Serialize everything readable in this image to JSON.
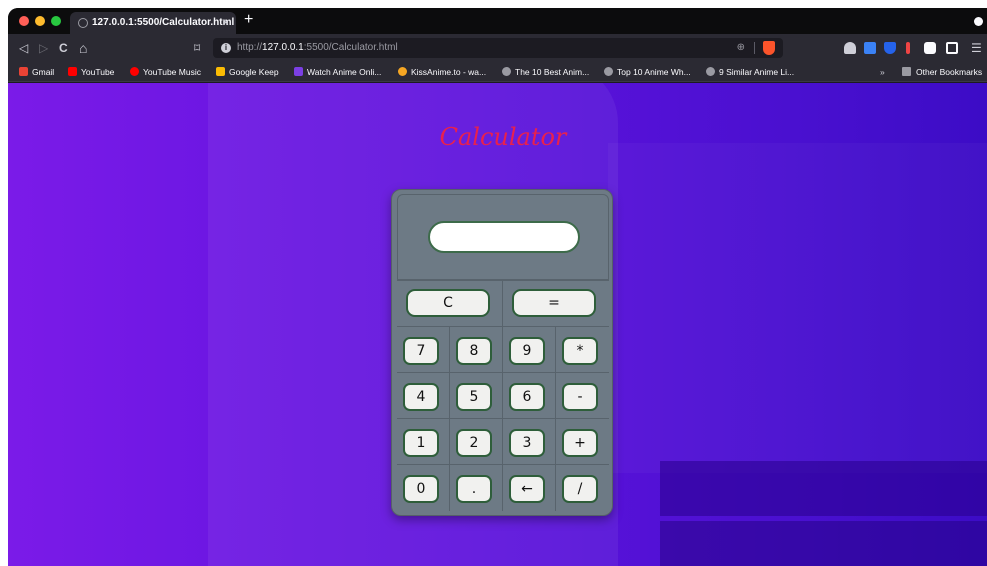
{
  "browser": {
    "tab_title": "127.0.0.1:5500/Calculator.html",
    "tab_close": "×",
    "new_tab": "+",
    "url_prefix": "http://",
    "url_host": "127.0.0.1",
    "url_path": ":5500/Calculator.html",
    "url_info": "i",
    "nav": {
      "back": "◁",
      "forward": "▷",
      "reload": "C",
      "home": "⌂",
      "bookmark": "⌑",
      "menu": "☰"
    },
    "zoom_icon": "⊕"
  },
  "bookmarks": [
    {
      "label": "Gmail",
      "color": "#ea4335"
    },
    {
      "label": "YouTube",
      "color": "#ff0000"
    },
    {
      "label": "YouTube Music",
      "color": "#ff0000"
    },
    {
      "label": "Google Keep",
      "color": "#fbbc04"
    },
    {
      "label": "Watch Anime Onli...",
      "color": "#7b3fe4"
    },
    {
      "label": "KissAnime.to - wa...",
      "color": "#f5a623"
    },
    {
      "label": "The 10 Best Anim...",
      "color": "#9a9aa2"
    },
    {
      "label": "Top 10 Anime Wh...",
      "color": "#9a9aa2"
    },
    {
      "label": "9 Similar Anime Li...",
      "color": "#9a9aa2"
    }
  ],
  "bookmarks_overflow": "»",
  "other_bookmarks": "Other Bookmarks",
  "page": {
    "title": "Calculator",
    "display_value": "",
    "buttons": {
      "clear": "C",
      "equals": "=",
      "rows": [
        [
          "7",
          "8",
          "9",
          "*"
        ],
        [
          "4",
          "5",
          "6",
          "-"
        ],
        [
          "1",
          "2",
          "3",
          "+"
        ],
        [
          "0",
          ".",
          "←",
          "/"
        ]
      ]
    }
  },
  "colors": {
    "title": "#e8214d",
    "calculator_body": "#6d7a85",
    "button_border": "#2e5e3a",
    "page_gradient_start": "#7b1be8",
    "page_gradient_end": "#3c0cc6"
  }
}
